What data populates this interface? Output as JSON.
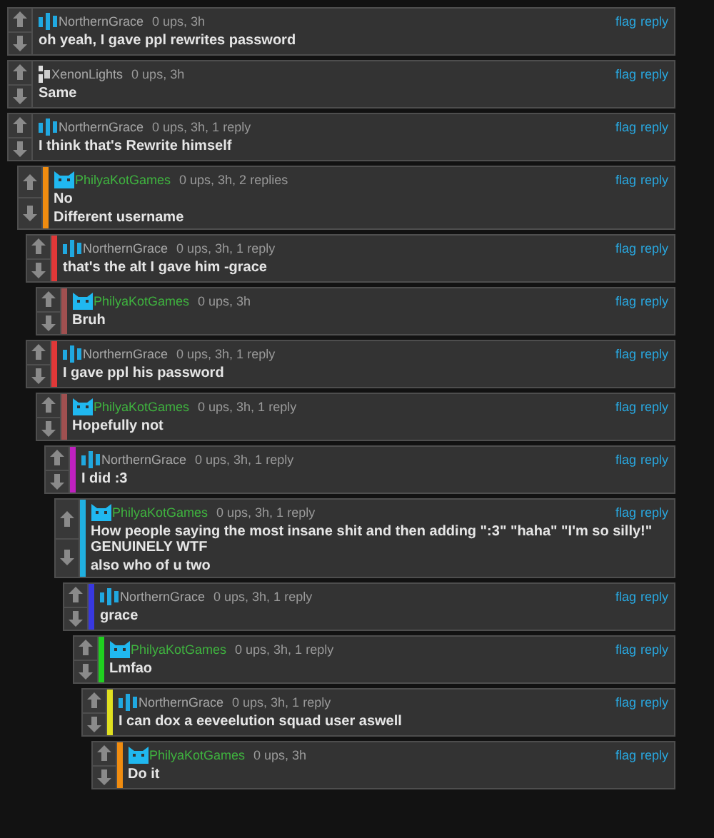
{
  "comments": [
    {
      "author": {
        "name": "NorthernGrace",
        "color": "#a8a8a8"
      },
      "avatar": {
        "kind": "bars"
      },
      "meta": "0 ups, 3h",
      "actions": [
        "flag",
        "reply"
      ],
      "lines": [
        "oh yeah, I gave ppl rewrites password"
      ]
    },
    {
      "author": {
        "name": "XenonLights",
        "color": "#a8a8a8"
      },
      "avatar": {
        "kind": "pixel"
      },
      "meta": "0 ups, 3h",
      "actions": [
        "flag",
        "reply"
      ],
      "lines": [
        "Same"
      ]
    },
    {
      "author": {
        "name": "NorthernGrace",
        "color": "#a8a8a8"
      },
      "avatar": {
        "kind": "bars"
      },
      "meta": "0 ups, 3h, 1 reply",
      "actions": [
        "flag",
        "reply"
      ],
      "lines": [
        "I think that's Rewrite himself"
      ],
      "children": [
        {
          "author": {
            "name": "PhilyaKotGames",
            "color": "#3fb33f"
          },
          "avatar": {
            "kind": "cat"
          },
          "color": "#f08c10",
          "meta": "0 ups, 3h, 2 replies",
          "actions": [
            "flag",
            "reply"
          ],
          "lines": [
            "No",
            "Different username"
          ],
          "children": [
            {
              "author": {
                "name": "NorthernGrace",
                "color": "#a8a8a8"
              },
              "avatar": {
                "kind": "bars"
              },
              "color": "#e03838",
              "meta": "0 ups, 3h, 1 reply",
              "actions": [
                "flag",
                "reply"
              ],
              "lines": [
                "that's the alt I gave him -grace"
              ],
              "children": [
                {
                  "author": {
                    "name": "PhilyaKotGames",
                    "color": "#3fb33f"
                  },
                  "avatar": {
                    "kind": "cat"
                  },
                  "color": "#a05050",
                  "meta": "0 ups, 3h",
                  "actions": [
                    "flag",
                    "reply"
                  ],
                  "lines": [
                    "Bruh"
                  ]
                }
              ]
            },
            {
              "author": {
                "name": "NorthernGrace",
                "color": "#a8a8a8"
              },
              "avatar": {
                "kind": "bars"
              },
              "color": "#e03838",
              "meta": "0 ups, 3h, 1 reply",
              "actions": [
                "flag",
                "reply"
              ],
              "lines": [
                "I gave ppl his password"
              ],
              "children": [
                {
                  "author": {
                    "name": "PhilyaKotGames",
                    "color": "#3fb33f"
                  },
                  "avatar": {
                    "kind": "cat"
                  },
                  "color": "#a05050",
                  "meta": "0 ups, 3h, 1 reply",
                  "actions": [
                    "flag",
                    "reply"
                  ],
                  "lines": [
                    "Hopefully not"
                  ],
                  "children": [
                    {
                      "author": {
                        "name": "NorthernGrace",
                        "color": "#a8a8a8"
                      },
                      "avatar": {
                        "kind": "bars"
                      },
                      "color": "#c020c0",
                      "meta": "0 ups, 3h, 1 reply",
                      "actions": [
                        "flag",
                        "reply"
                      ],
                      "lines": [
                        "I did :3"
                      ],
                      "children": [
                        {
                          "author": {
                            "name": "PhilyaKotGames",
                            "color": "#3fb33f"
                          },
                          "avatar": {
                            "kind": "cat"
                          },
                          "color": "#20b0e0",
                          "meta": "0 ups, 3h, 1 reply",
                          "actions": [
                            "flag",
                            "reply"
                          ],
                          "lines": [
                            "How people saying the most insane shit and then adding \":3\" \"haha\" \"I'm so silly!\" GENUINELY WTF",
                            "also who of u two"
                          ],
                          "children": [
                            {
                              "author": {
                                "name": "NorthernGrace",
                                "color": "#a8a8a8"
                              },
                              "avatar": {
                                "kind": "bars"
                              },
                              "color": "#3838e0",
                              "meta": "0 ups, 3h, 1 reply",
                              "actions": [
                                "flag",
                                "reply"
                              ],
                              "lines": [
                                "grace"
                              ],
                              "children": [
                                {
                                  "author": {
                                    "name": "PhilyaKotGames",
                                    "color": "#3fb33f"
                                  },
                                  "avatar": {
                                    "kind": "cat"
                                  },
                                  "color": "#20d020",
                                  "meta": "0 ups, 3h, 1 reply",
                                  "actions": [
                                    "flag",
                                    "reply"
                                  ],
                                  "lines": [
                                    "Lmfao"
                                  ],
                                  "children": [
                                    {
                                      "author": {
                                        "name": "NorthernGrace",
                                        "color": "#a8a8a8"
                                      },
                                      "avatar": {
                                        "kind": "bars"
                                      },
                                      "color": "#e0e020",
                                      "meta": "0 ups, 3h, 1 reply",
                                      "actions": [
                                        "flag",
                                        "reply"
                                      ],
                                      "lines": [
                                        "I can dox a eeveelution squad user aswell"
                                      ],
                                      "children": [
                                        {
                                          "author": {
                                            "name": "PhilyaKotGames",
                                            "color": "#3fb33f"
                                          },
                                          "avatar": {
                                            "kind": "cat"
                                          },
                                          "color": "#f08c10",
                                          "meta": "0 ups, 3h",
                                          "actions": [
                                            "flag",
                                            "reply"
                                          ],
                                          "lines": [
                                            "Do it"
                                          ]
                                        }
                                      ]
                                    }
                                  ]
                                }
                              ]
                            }
                          ]
                        }
                      ]
                    }
                  ]
                }
              ]
            }
          ]
        }
      ]
    }
  ]
}
